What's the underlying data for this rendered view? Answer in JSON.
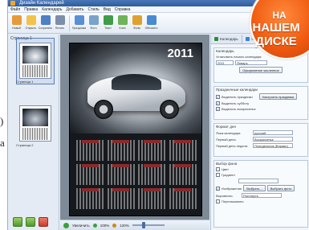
{
  "window": {
    "title": "Дизайн Календарей",
    "menu": [
      "Файл",
      "Правка",
      "Календарь",
      "Добавить",
      "Стиль",
      "Вид",
      "Справка"
    ]
  },
  "toolbar": {
    "buttons": [
      {
        "label": "Новый",
        "icon": "new-icon",
        "color": "#e89a3a"
      },
      {
        "label": "Открыть",
        "icon": "open-icon",
        "color": "#f3c24a"
      },
      {
        "label": "Сохранить",
        "icon": "save-icon",
        "color": "#4f7fc4"
      },
      {
        "label": "Печать",
        "icon": "print-icon",
        "color": "#7d8ea8"
      },
      {
        "label": "Праздники",
        "icon": "holidays-icon",
        "color": "#5a8fd6"
      },
      {
        "label": "Фото",
        "icon": "photo-icon",
        "color": "#7aa3c9"
      },
      {
        "label": "Текст",
        "icon": "text-icon",
        "color": "#3f9d4a"
      },
      {
        "label": "Клип",
        "icon": "clipart-icon",
        "color": "#6fb35a"
      },
      {
        "label": "Фоны",
        "icon": "backgrounds-icon",
        "color": "#e0a030"
      },
      {
        "label": "Обновить",
        "icon": "refresh-icon",
        "color": "#4a8ad0"
      }
    ]
  },
  "left_panel": {
    "header": "Страница 1",
    "pages": [
      "Страница 1",
      "Страница 2"
    ]
  },
  "calendar_page": {
    "year": "2011"
  },
  "right_panel": {
    "tabs": [
      "Календарь",
      "Элементы"
    ],
    "section_start": {
      "title": "Календарь",
      "label": "Установить начало календаря:",
      "year": "2011",
      "month": "Январь",
      "button": "Оформление численное"
    },
    "section_holidays": {
      "title": "Праздничные календари",
      "options": [
        "Выделять праздники",
        "Выделять субботу",
        "Выделять воскресенье"
      ],
      "button": "Настроить праздники"
    },
    "section_week": {
      "title": "Формат дня",
      "rows": [
        {
          "label": "Язык календаря:",
          "value": "русский"
        },
        {
          "label": "Первый день:",
          "value": "Воскресенье"
        },
        {
          "label": "Первый день недели:",
          "value": "Понедельник (Вправо)"
        }
      ]
    },
    "section_style": {
      "title": "Выбор фона",
      "options": [
        "Цвет",
        "Градиент",
        "Изображение",
        "Перетаскивать"
      ],
      "buttons": [
        "Выбрать...",
        "Выбрать фото"
      ],
      "fill_label": "Выровнять:",
      "fill_value": "Растянуть"
    }
  },
  "status": {
    "zoom_label": "Увеличить",
    "zoom_values": [
      "100%",
      "120%"
    ]
  },
  "badge": {
    "line1": "НА",
    "line2": "НАШЕМ",
    "line3": "ДИСКЕ"
  },
  "page_edge": {
    "fragments": [
      ")",
      "а"
    ]
  }
}
